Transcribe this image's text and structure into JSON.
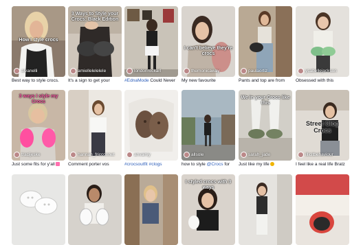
{
  "rows": [
    [
      {
        "user": "aivanelli",
        "overlay": "How I style crocs",
        "caption": "Best way to style crocs."
      },
      {
        "user": "amielleleleleIe",
        "overlay": "3 Ways to Style your Crocs: Black Edition",
        "caption": "It's a sign to get your"
      },
      {
        "user": "londonrockarl",
        "overlay": "",
        "caption_tag": "#EdnaMode",
        "caption": " Could Never"
      },
      {
        "user": "themonicaway",
        "overlay": "I can't believe they're crocs",
        "caption": "My new favourite"
      },
      {
        "user": "paulaortiz",
        "overlay": "",
        "caption": "Pants and top are from"
      },
      {
        "user": "ysabellejackson",
        "overlay": "",
        "caption": "Obsessed with this"
      }
    ],
    [
      {
        "user": "tracijeske",
        "overlay": "3 ways I style my Crocs",
        "caption": "Just some fits for y'all",
        "emoji": "pink"
      },
      {
        "user": "hannah_fricconnet",
        "overlay": "",
        "caption": "Comment porter vos"
      },
      {
        "user": "anvainiy",
        "overlay": "",
        "caption_tag": "#crocsoutfit #clogs",
        "caption": ""
      },
      {
        "user": "allsole",
        "overlay": "",
        "caption": "how to style ",
        "caption_tag2": "@Crocs",
        "caption2": " for"
      },
      {
        "user": "sarah_jade",
        "overlay": "We in your Crocs like this",
        "caption": "Just like my life",
        "emoji": "yellow"
      },
      {
        "user": "illicitbehaviour",
        "overlay": "Street Clog Crocs",
        "caption": "I feel like a real life Bratz"
      }
    ],
    [
      {
        "user": "",
        "overlay": "",
        "caption": ""
      },
      {
        "user": "",
        "overlay": "",
        "caption": ""
      },
      {
        "user": "",
        "overlay": "",
        "caption": ""
      },
      {
        "user": "",
        "overlay": "I styled crocs with 3 ways",
        "caption": ""
      },
      {
        "user": "",
        "overlay": "",
        "caption": ""
      },
      {
        "user": "",
        "overlay": "",
        "caption": ""
      }
    ]
  ],
  "colors": {
    "caption_text": "#161823",
    "hashtag": "#2b5db9",
    "overlay_text": "#ffffff"
  }
}
